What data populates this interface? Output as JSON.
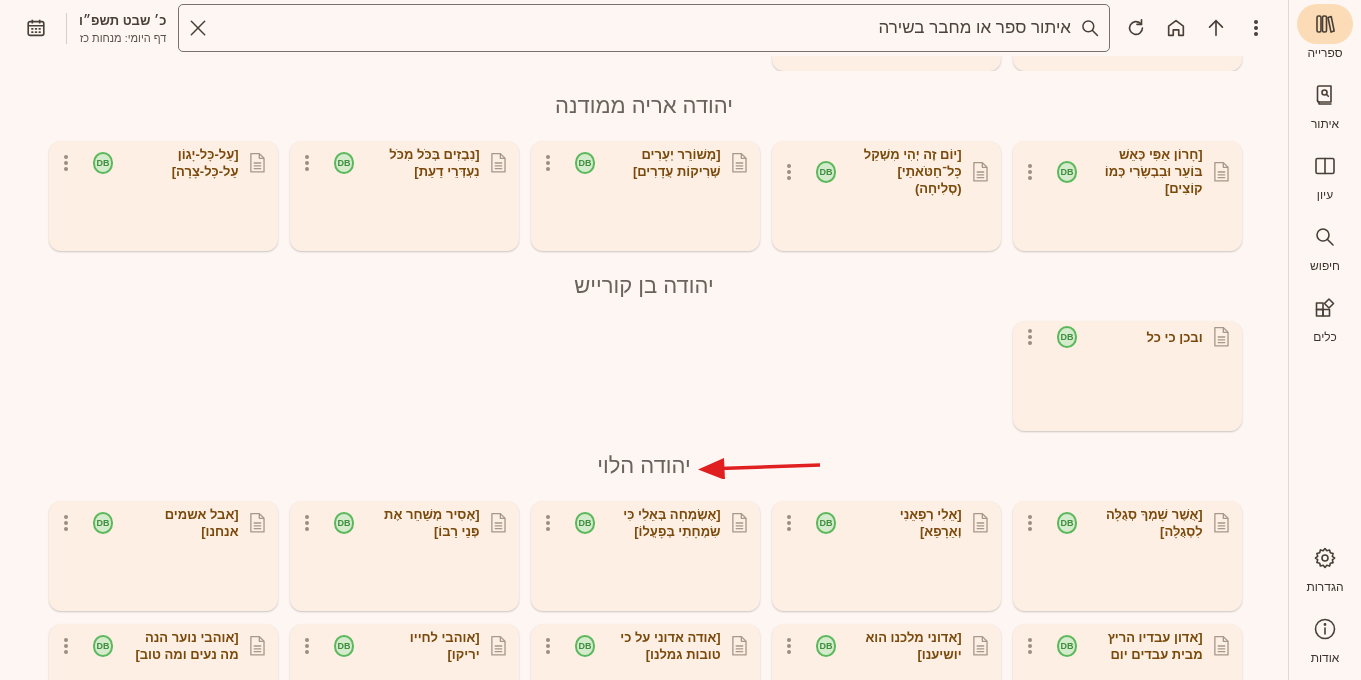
{
  "topbar": {
    "date": "כ׳ שבט תשפ״ו",
    "daf": "דף היומי: מנחות כז",
    "search": {
      "placeholder": "איתור ספר או מחבר בשירה"
    }
  },
  "sidebar": {
    "items": [
      {
        "label": "ספרייה",
        "selected": true
      },
      {
        "label": "איתור",
        "selected": false
      },
      {
        "label": "עיון",
        "selected": false
      },
      {
        "label": "חיפוש",
        "selected": false
      },
      {
        "label": "כלים",
        "selected": false
      }
    ],
    "bottom_items": [
      {
        "label": "הגדרות"
      },
      {
        "label": "אודות"
      }
    ]
  },
  "clipped_row": [
    {
      "kind": "card"
    },
    {
      "kind": "card"
    }
  ],
  "sections": [
    {
      "heading": "יהודה אריה ממודנה",
      "pointer_arrow": false,
      "cards": [
        {
          "title": "[חָרוֹן אַפִּי כְּאֵשׁ בּוֹעֵר וּבִבְשָׂרִי כְּמוֹ קוֹצִים]",
          "badge": "DB"
        },
        {
          "title": "[יוֹם זֶה יְהִי מִשְׁקַל כָּל־חַטֹּאתַי] (סְלִיחָה)",
          "badge": "DB"
        },
        {
          "title": "[מְשׁוֹרֵר יְעָרִים שְׁרִיקוֹת עֲדָרִים]",
          "badge": "DB"
        },
        {
          "title": "[נִבְזִים בְּכֹּל מִכֹּל נִעְדְּרֵי דַעַת]",
          "badge": "DB"
        },
        {
          "title": "[עַל-כָּל-יָגוֹן עַל-כָּל-צָרָה]",
          "badge": "DB"
        }
      ]
    },
    {
      "heading": "יהודה בן קורייש",
      "pointer_arrow": false,
      "cards": [
        {
          "title": "ובכן כי כל",
          "badge": "DB"
        }
      ]
    },
    {
      "heading": "יהודה הלוי",
      "pointer_arrow": true,
      "cards": [
        {
          "title": "[אֲשֶׁר שָׁמְךָ סְגֻלָּה לִסְגֻלָּה]",
          "badge": "DB"
        },
        {
          "title": "[אֵלִי רְפָאֵנִי וְאֵרָפֵא]",
          "badge": "DB"
        },
        {
          "title": "[אֶשְׂמְחָה בְּאֵלִי כִּי שִׂמְחָתִי בְּפָעֳלוֹ]",
          "badge": "DB"
        },
        {
          "title": "[אָסִיר מְשַׁחֵר אֶת פְּנֵי רַבּוֹ]",
          "badge": "DB"
        },
        {
          "title": "[אבל אשמים אנחנו]",
          "badge": "DB"
        },
        {
          "title": "[אדון עבדיו הריץ מבית עבדים יום",
          "badge": "DB"
        },
        {
          "title": "[אדוני מלכנו הוא יושיענו]",
          "badge": "DB"
        },
        {
          "title": "[אודה אדוני על כי טובות גמלנו]",
          "badge": "DB"
        },
        {
          "title": "[אוהבי לחייו יריקו]",
          "badge": "DB"
        },
        {
          "title": "[אוהבי נוער הנה מה נעים ומה טוב]",
          "badge": "DB"
        }
      ]
    }
  ]
}
